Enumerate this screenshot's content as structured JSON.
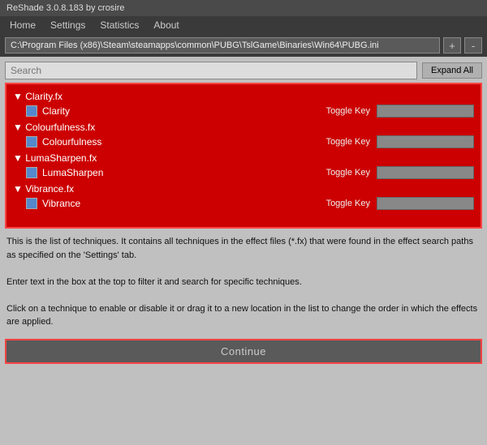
{
  "titleBar": {
    "label": "ReShade 3.0.8.183 by crosire"
  },
  "menuBar": {
    "items": [
      "Home",
      "Settings",
      "Statistics",
      "About"
    ]
  },
  "pathBar": {
    "path": "C:\\Program Files (x86)\\Steam\\steamapps\\common\\PUBG\\TslGame\\Binaries\\Win64\\PUBG.ini",
    "addBtn": "+",
    "removeBtn": "-"
  },
  "search": {
    "placeholder": "Search",
    "expandAll": "Expand All"
  },
  "effectGroups": [
    {
      "id": "clarity",
      "header": "▼ Clarity.fx",
      "items": [
        {
          "name": "Clarity",
          "color": "#5588cc",
          "toggleLabel": "Toggle Key",
          "toggleValue": ""
        }
      ]
    },
    {
      "id": "colourfulness",
      "header": "▼ Colourfulness.fx",
      "items": [
        {
          "name": "Colourfulness",
          "color": "#5588cc",
          "toggleLabel": "Toggle Key",
          "toggleValue": ""
        }
      ]
    },
    {
      "id": "lumasharpen",
      "header": "▼ LumaSharpen.fx",
      "items": [
        {
          "name": "LumaSharpen",
          "color": "#5588cc",
          "toggleLabel": "Toggle Key",
          "toggleValue": ""
        }
      ]
    },
    {
      "id": "vibrance",
      "header": "▼ Vibrance.fx",
      "items": [
        {
          "name": "Vibrance",
          "color": "#5588cc",
          "toggleLabel": "Toggle Key",
          "toggleValue": ""
        }
      ]
    }
  ],
  "infoText": {
    "line1": "This is the list of techniques. It contains all techniques in the effect files (*.fx) that were found in the effect search paths as specified on the 'Settings' tab.",
    "line2": "Enter text in the box at the top to filter it and search for specific techniques.",
    "line3": "Click on a technique to enable or disable it or drag it to a new location in the list to change the order in which the effects are applied."
  },
  "continueBtn": "Continue"
}
